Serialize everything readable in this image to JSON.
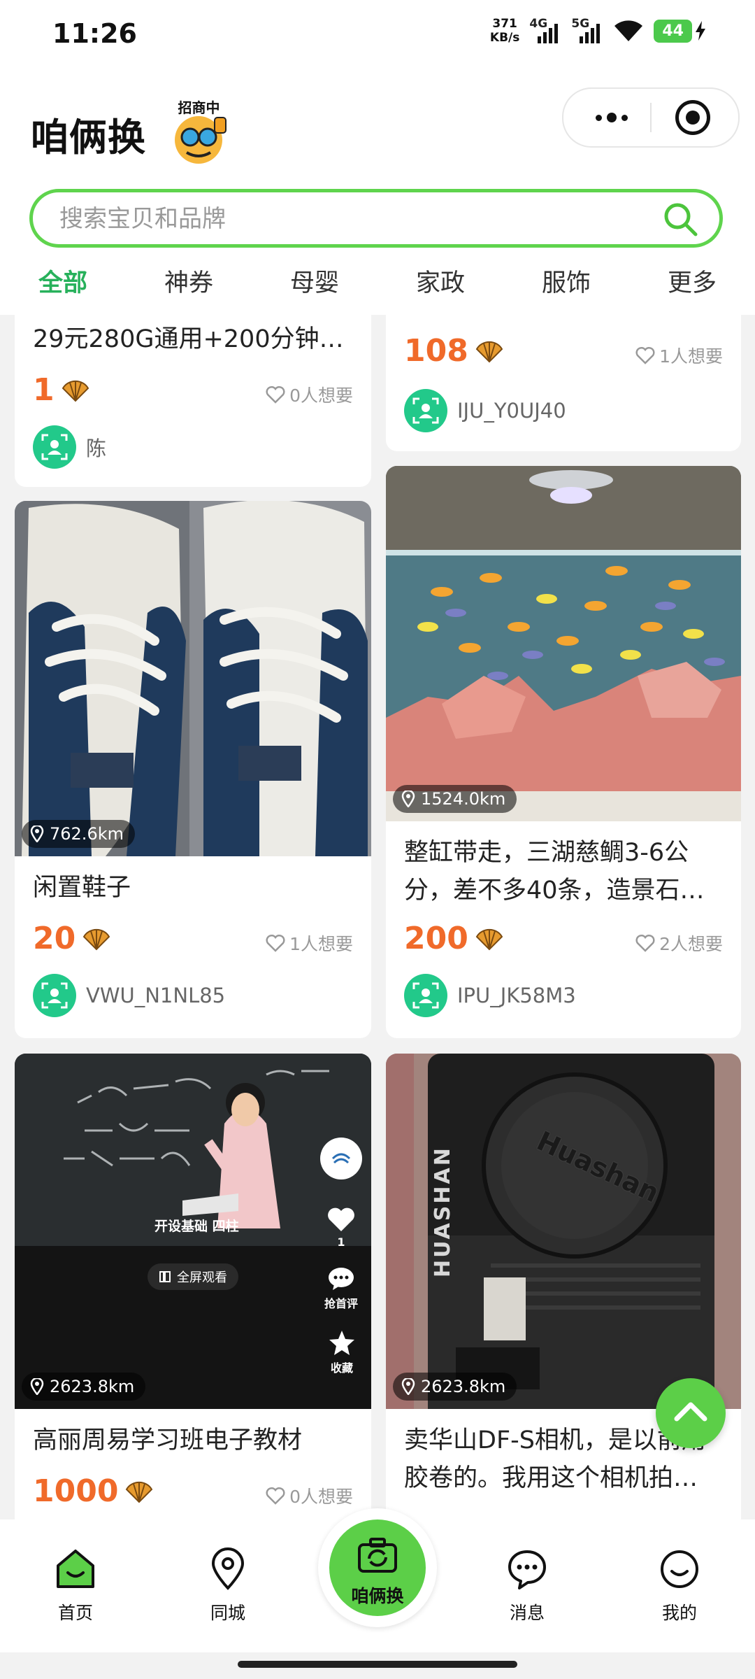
{
  "status_bar": {
    "time": "11:26",
    "net_speed_value": "371",
    "net_speed_unit": "KB/s",
    "signal_1": "4G",
    "signal_2": "5G",
    "battery": "44"
  },
  "header": {
    "title": "咱俩换",
    "recruit_badge": "招商中"
  },
  "search": {
    "placeholder": "搜索宝贝和品牌"
  },
  "tabs": [
    "全部",
    "神券",
    "母婴",
    "家政",
    "服饰",
    "更多"
  ],
  "feed": {
    "cards": [
      {
        "title": "29元280G通用+200分钟…",
        "price": "1",
        "wants": "0人想要",
        "seller": "陈"
      },
      {
        "title": "",
        "price": "108",
        "wants": "1人想要",
        "seller": "IJU_Y0UJ40"
      },
      {
        "title": "闲置鞋子",
        "price": "20",
        "wants": "1人想要",
        "seller": "VWU_N1NL85",
        "distance": "762.6km"
      },
      {
        "title": "整缸带走，三湖慈鲷3-6公分，差不多40条，造景石…",
        "price": "200",
        "wants": "2人想要",
        "seller": "IPU_JK58M3",
        "distance": "1524.0km"
      },
      {
        "title": "高丽周易学习班电子教材",
        "price": "1000",
        "wants": "0人想要",
        "distance": "2623.8km",
        "video_overlay": {
          "caption": "开设基础 四柱",
          "fullscreen": "全屏观看",
          "like_count": "1",
          "comment": "抢首评",
          "favorite": "收藏"
        }
      },
      {
        "title": "卖华山DF-S相机，是以前用胶卷的。我用这个相机拍…",
        "distance": "2623.8km",
        "camera_brand": "HUASHAN",
        "lens_cap_text": "Huashan"
      }
    ]
  },
  "bottom_nav": [
    {
      "label": "首页",
      "icon": "home-icon"
    },
    {
      "label": "同城",
      "icon": "location-icon"
    },
    {
      "label": "咱俩换",
      "icon": "exchange-camera-icon"
    },
    {
      "label": "消息",
      "icon": "message-icon"
    },
    {
      "label": "我的",
      "icon": "profile-icon"
    }
  ],
  "colors": {
    "accent_green": "#5ccf48",
    "active_tab": "#27b15b",
    "price_orange": "#f06a2a",
    "avatar_green": "#22c98a"
  }
}
